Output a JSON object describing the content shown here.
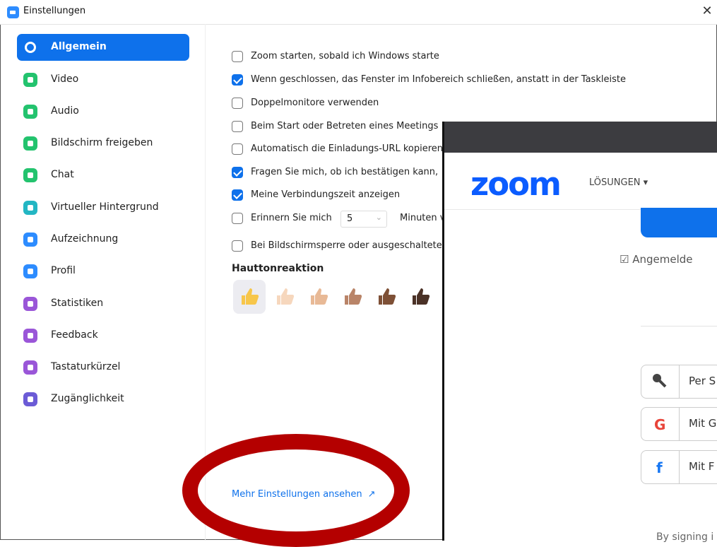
{
  "window": {
    "title": "Einstellungen",
    "close_glyph": "✕"
  },
  "sidebar": {
    "items": [
      {
        "label": "Allgemein",
        "icon": "gear-icon",
        "color": "#0e71eb",
        "active": true
      },
      {
        "label": "Video",
        "icon": "video-icon",
        "color": "#23c36e"
      },
      {
        "label": "Audio",
        "icon": "headphones-icon",
        "color": "#23c36e"
      },
      {
        "label": "Bildschirm freigeben",
        "icon": "share-screen-icon",
        "color": "#23c36e"
      },
      {
        "label": "Chat",
        "icon": "chat-icon",
        "color": "#23c36e"
      },
      {
        "label": "Virtueller Hintergrund",
        "icon": "background-icon",
        "color": "#23b6c3"
      },
      {
        "label": "Aufzeichnung",
        "icon": "record-icon",
        "color": "#2d8cff"
      },
      {
        "label": "Profil",
        "icon": "profile-icon",
        "color": "#2d8cff"
      },
      {
        "label": "Statistiken",
        "icon": "statistics-icon",
        "color": "#9a56d8"
      },
      {
        "label": "Feedback",
        "icon": "feedback-icon",
        "color": "#9a56d8"
      },
      {
        "label": "Tastaturkürzel",
        "icon": "keyboard-icon",
        "color": "#9a56d8"
      },
      {
        "label": "Zugänglichkeit",
        "icon": "accessibility-icon",
        "color": "#6b5bd6"
      }
    ]
  },
  "general": {
    "options": [
      {
        "label": "Zoom starten, sobald ich Windows starte",
        "checked": false
      },
      {
        "label": "Wenn geschlossen, das Fenster im Infobereich schließen, anstatt in der Taskleiste",
        "checked": true
      },
      {
        "label": "Doppelmonitore verwenden",
        "checked": false
      },
      {
        "label": "Beim Start oder Betreten eines Meetings",
        "checked": false
      },
      {
        "label": "Automatisch die Einladungs-URL kopieren",
        "checked": false
      },
      {
        "label": "Fragen Sie mich, ob ich bestätigen kann,",
        "checked": true
      },
      {
        "label": "Meine Verbindungszeit anzeigen",
        "checked": true
      },
      {
        "label": "Erinnern Sie mich",
        "checked": false,
        "select_value": "5",
        "after_label": "Minuten vo"
      },
      {
        "label": "Bei Bildschirmsperre oder ausgeschaltete",
        "checked": false
      }
    ],
    "skin_tone_heading": "Hauttonreaktion",
    "skin_tones": [
      "#f7c64a",
      "#f6d7bd",
      "#e8b996",
      "#b98468",
      "#7e5036",
      "#4a3126"
    ],
    "more_settings_link": "Mehr Einstellungen ansehen",
    "external_icon": "↗"
  },
  "browser": {
    "logo": "zoom",
    "solutions_menu": "LÖSUNGEN ▾",
    "remember_label": "☑ Angemelde",
    "sso_buttons": [
      {
        "label": "Per S",
        "icon": "key-icon"
      },
      {
        "label": "Mit G",
        "icon": "google-icon"
      },
      {
        "label": "Mit F",
        "icon": "facebook-icon"
      }
    ],
    "footer_text": "By signing i"
  }
}
